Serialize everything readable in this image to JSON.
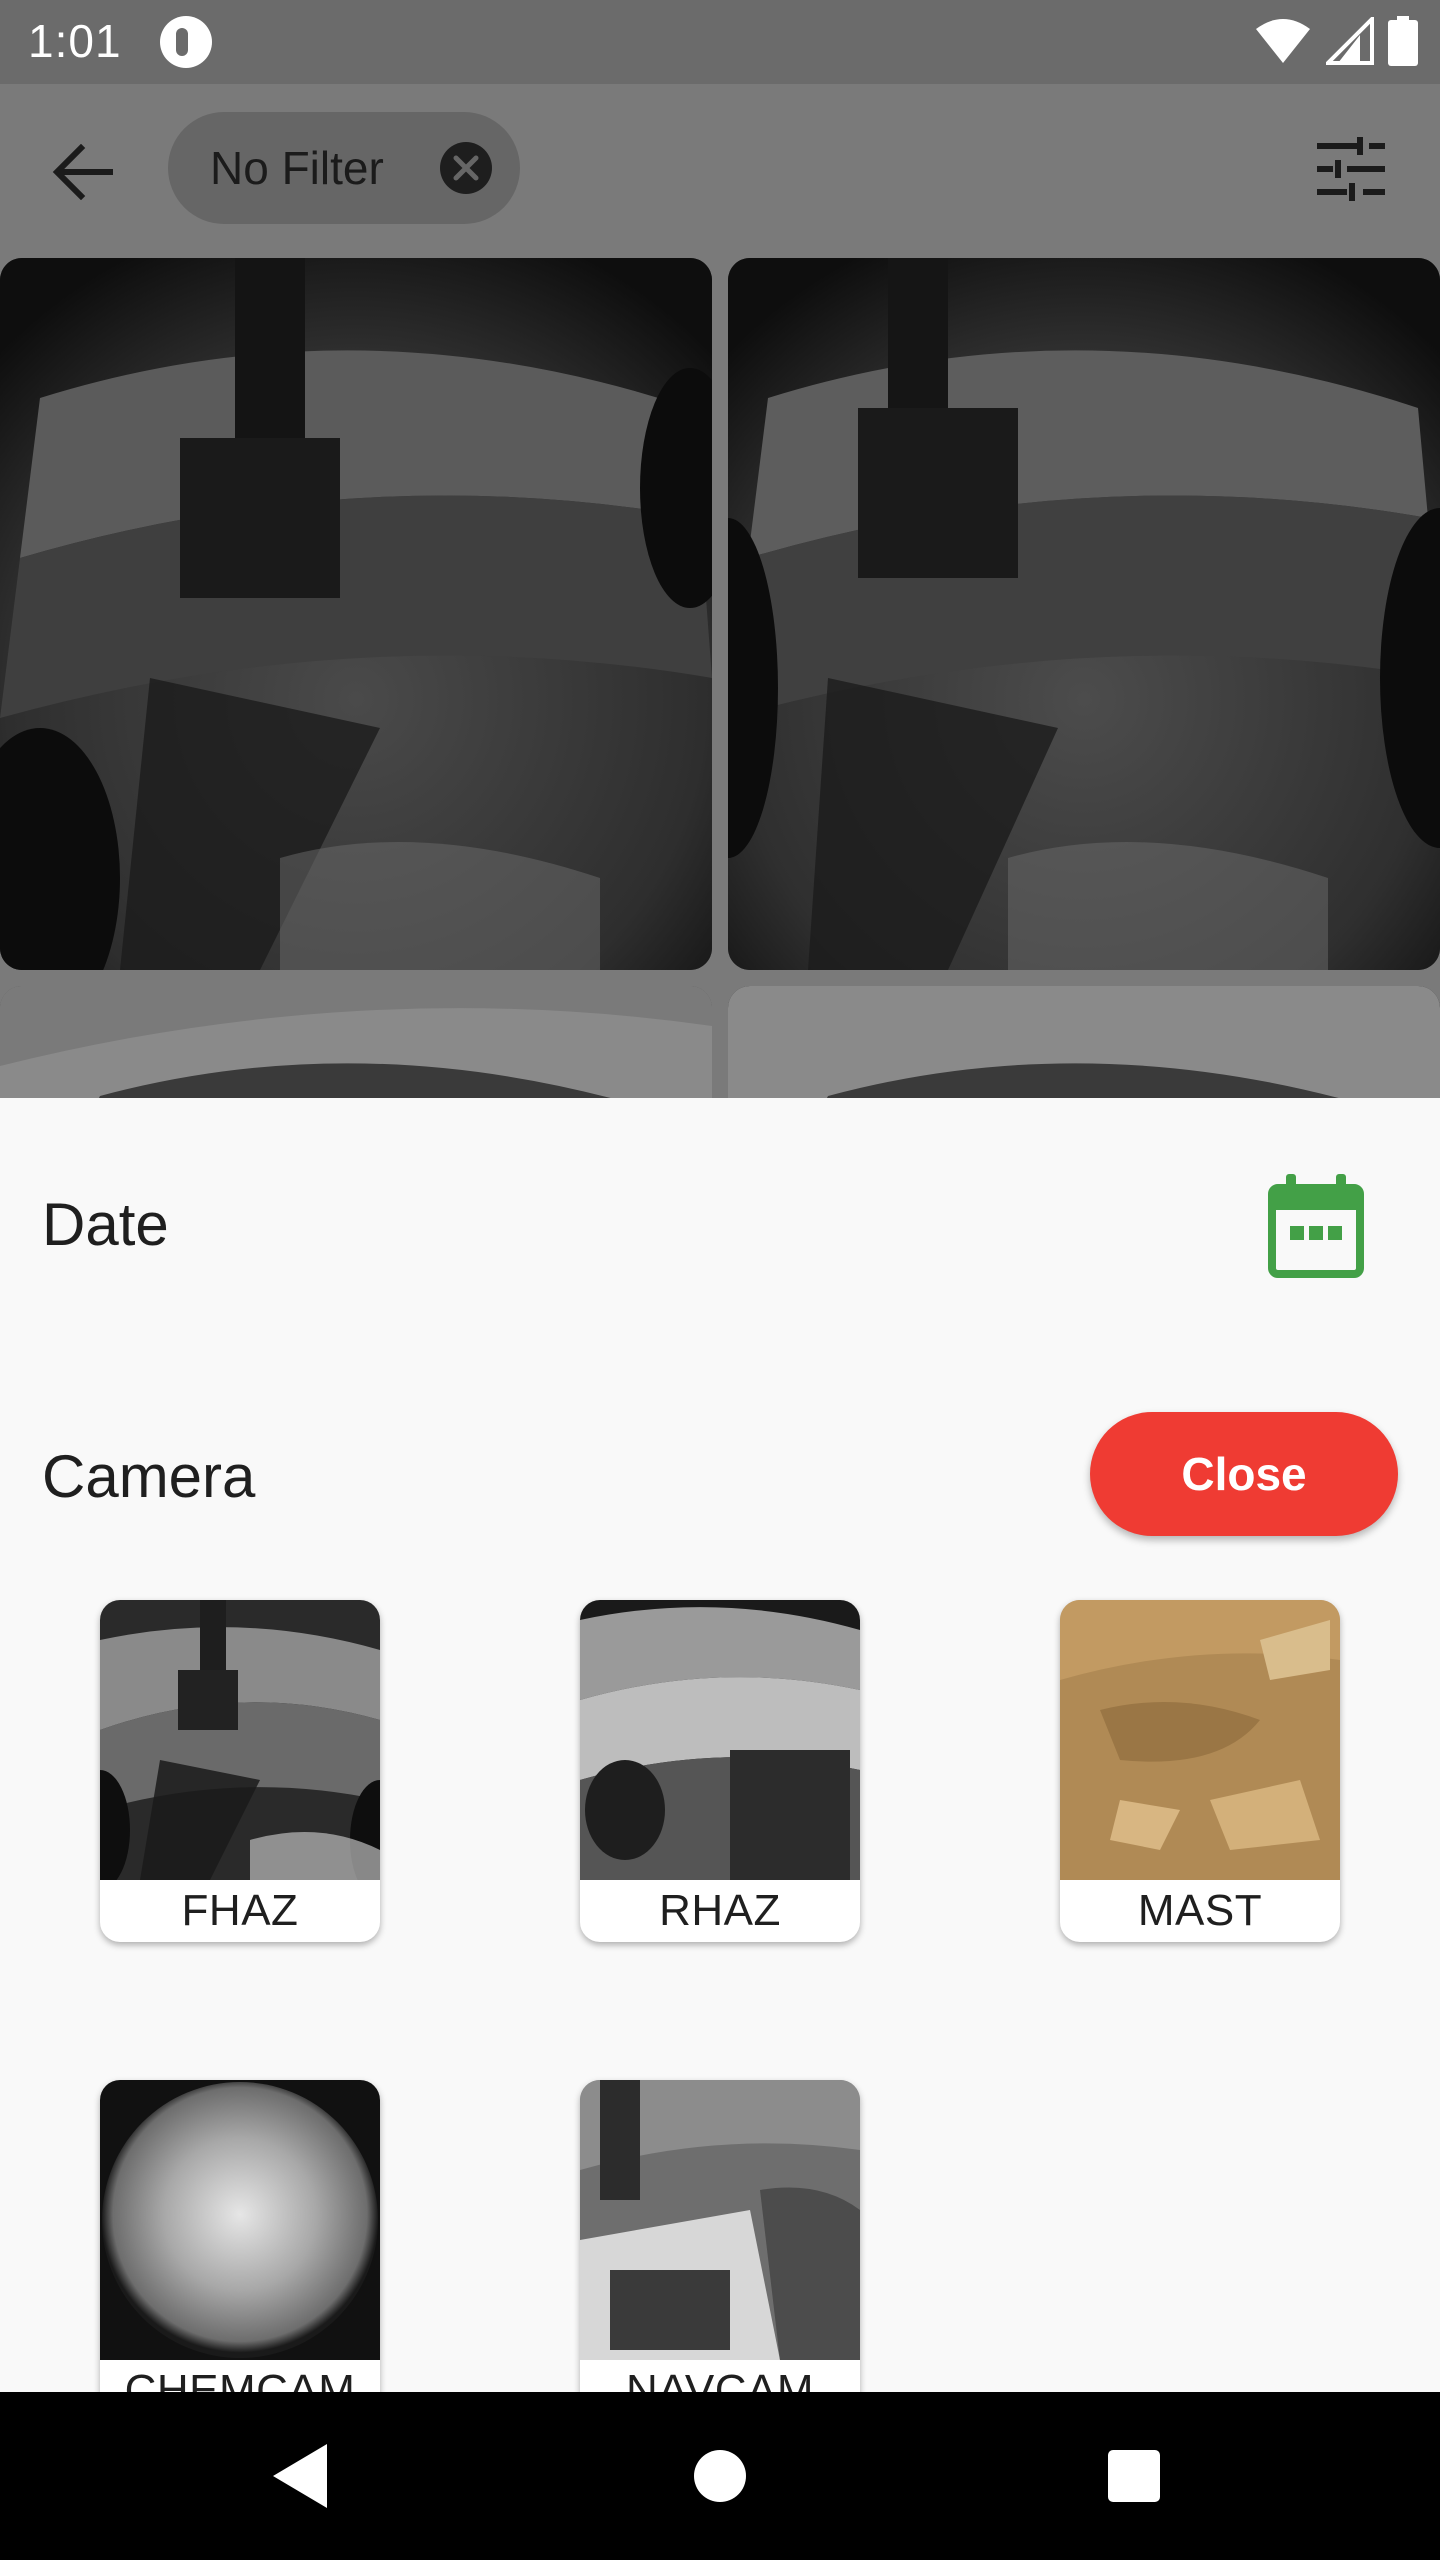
{
  "status_bar": {
    "time": "1:01",
    "icons": [
      "app-notification-icon",
      "wifi-icon",
      "signal-icon",
      "battery-icon"
    ]
  },
  "app_bar": {
    "back_icon": "arrow-back-icon",
    "filter_chip": {
      "label": "No Filter",
      "clear_icon": "close-circle-icon"
    },
    "filter_settings_icon": "tune-icon"
  },
  "photo_grid": {
    "description_icon": "rover-photo"
  },
  "sheet": {
    "date_title": "Date",
    "calendar_icon": "calendar-icon",
    "calendar_color": "#43a047",
    "camera_title": "Camera",
    "close_label": "Close",
    "close_color": "#ef3b33",
    "cameras": [
      {
        "label": "FHAZ"
      },
      {
        "label": "RHAZ"
      },
      {
        "label": "MAST"
      },
      {
        "label": "CHEMCAM"
      },
      {
        "label": "NAVCAM"
      }
    ]
  },
  "nav_bar": {
    "icons": [
      "nav-back-icon",
      "nav-home-icon",
      "nav-recents-icon"
    ]
  }
}
